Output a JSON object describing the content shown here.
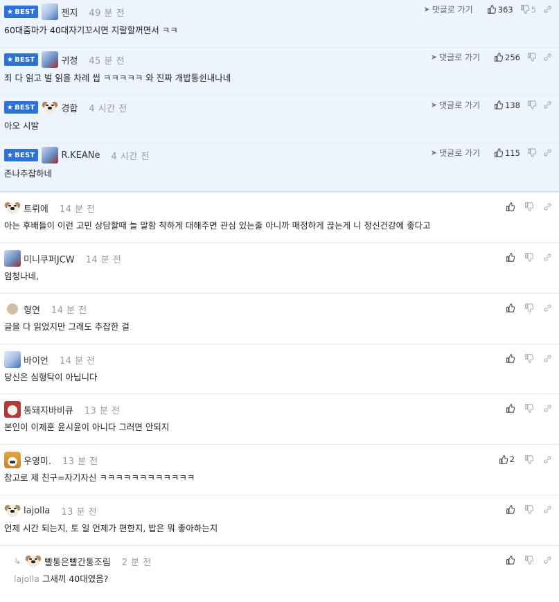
{
  "best_label": "BEST",
  "reply_link_label": "댓글로 가기",
  "best_comments": [
    {
      "avatar": "blue",
      "nick": "젠지",
      "time": "49 분 전",
      "text": "60대줌마가 40대자기꼬시면 지랄할꺼면서 ㅋㅋ",
      "likes": "363",
      "dislikes": "5"
    },
    {
      "avatar": "blue2",
      "nick": "귀정",
      "time": "45 분 전",
      "text": "죄 다 읽고 벌 읽을 차례 씹 ㅋㅋㅋㅋㅋ 와 진짜 개밥통쉰내나네",
      "likes": "256",
      "dislikes": ""
    },
    {
      "avatar": "dog",
      "nick": "경합",
      "time": "4 시간 전",
      "text": "아오 시발",
      "likes": "138",
      "dislikes": ""
    },
    {
      "avatar": "blue2",
      "nick": "R.KEANe",
      "time": "4 시간 전",
      "text": "존나추잡하네",
      "likes": "115",
      "dislikes": ""
    }
  ],
  "comments": [
    {
      "avatar": "dog",
      "nick": "트뤼에",
      "time": "14 분 전",
      "text": "아는 후배들이 이런 고민 상담할때 늘 말함 착하게 대해주면 관심 있는줄 아니까 매정하게 끊는게 니 정신건강에 좋다고",
      "likes": ""
    },
    {
      "avatar": "blue2",
      "nick": "미니쿠퍼JCW",
      "time": "14 분 전",
      "text": "엄청나네,",
      "likes": ""
    },
    {
      "avatar": "beige",
      "nick": "형연",
      "time": "14 분 전",
      "text": "글을 다 읽었지만 그래도 추잡한 걸",
      "likes": ""
    },
    {
      "avatar": "blue",
      "nick": "바이언",
      "time": "14 분 전",
      "text": "당신은 심형탁이 아닙니다",
      "likes": ""
    },
    {
      "avatar": "red",
      "nick": "통돼지바비큐",
      "time": "13 분 전",
      "text": "본인이 이제훈 윤시윤이 아니다 그러면 안되지",
      "likes": ""
    },
    {
      "avatar": "fox",
      "nick": "우영미.",
      "time": "13 분 전",
      "text": "참고로 제 친구=자기자신 ㅋㅋㅋㅋㅋㅋㅋㅋㅋㅋㅋㅋ",
      "likes": "2"
    },
    {
      "avatar": "dog",
      "nick": "lajolla",
      "time": "13 분 전",
      "text": "언제 시간 되는지, 토 일 언제가 편한지, 밥은 뭐 좋아하는지",
      "likes": ""
    }
  ],
  "reply": {
    "avatar": "dog",
    "nick": "빨통은빨간통조림",
    "time": "2 분 전",
    "mention": "lajolla",
    "text": "그새끼 40대였음?",
    "likes": ""
  }
}
